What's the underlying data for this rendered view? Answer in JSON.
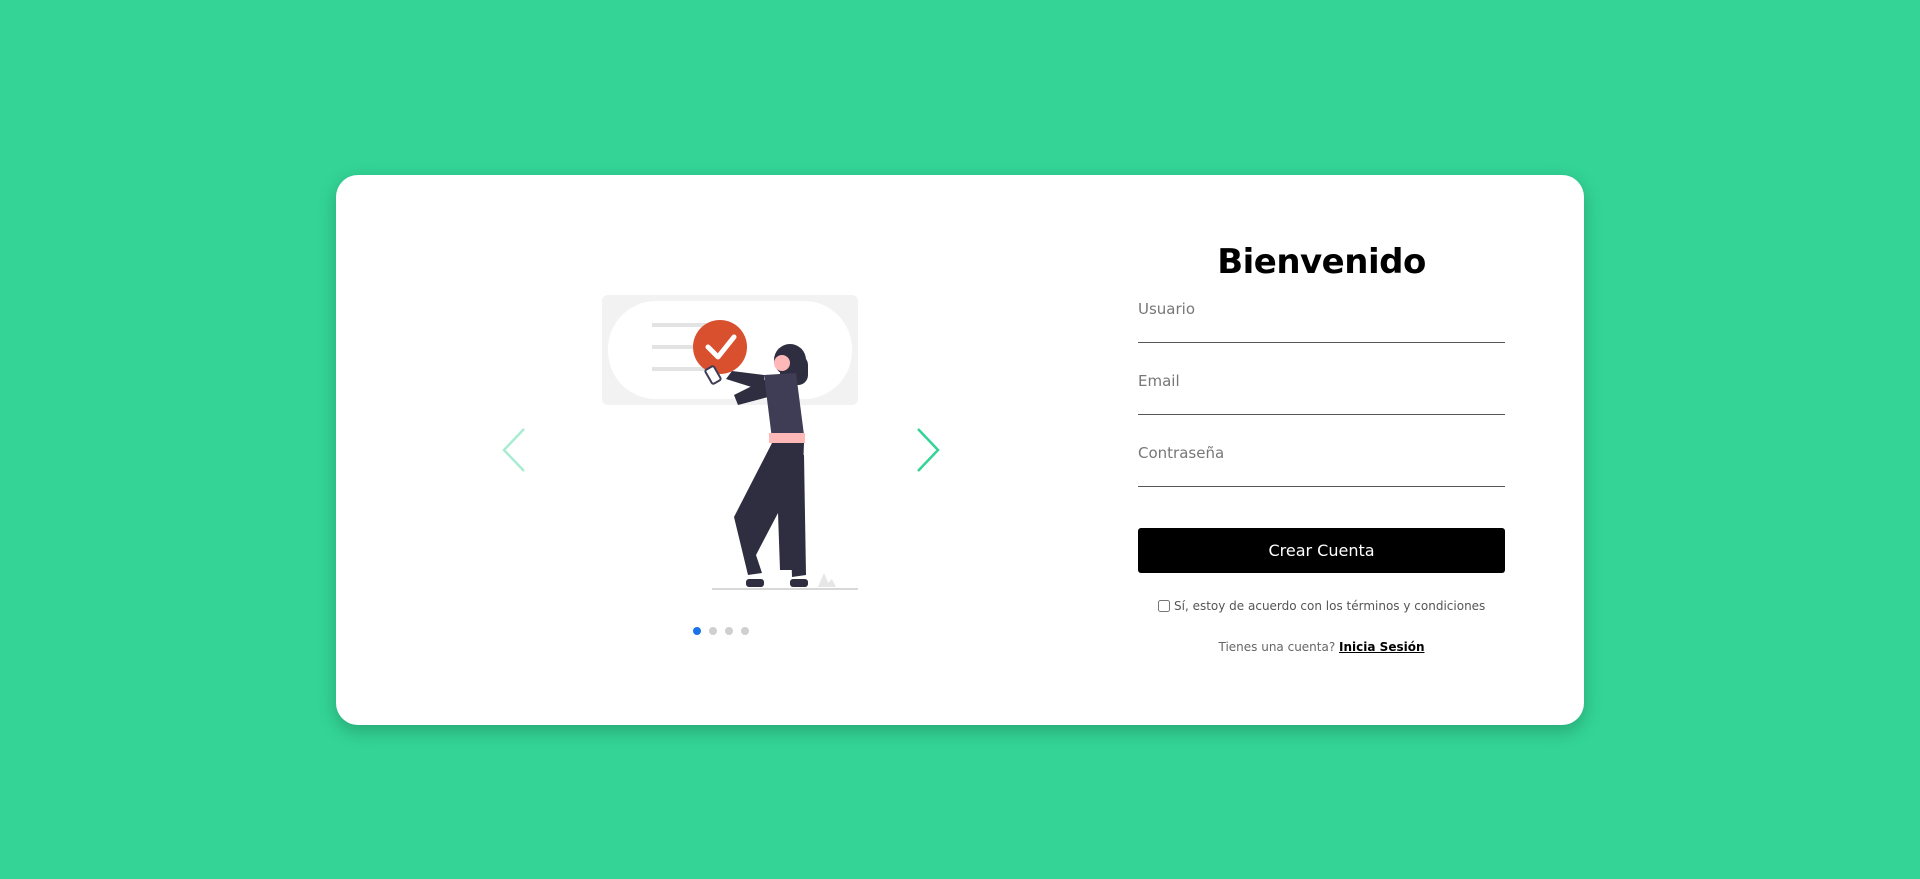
{
  "carousel": {
    "prev_icon": "chevron-left-icon",
    "next_icon": "chevron-right-icon",
    "slide_count": 4,
    "active_slide": 1
  },
  "form": {
    "title": "Bienvenido",
    "username_placeholder": "Usuario",
    "email_placeholder": "Email",
    "password_placeholder": "Contraseña",
    "submit_label": "Crear Cuenta",
    "terms_label": "Sí, estoy de acuerdo con los términos y condiciones",
    "login_prompt": "Tienes una cuenta?",
    "login_link": "Inicia Sesión"
  },
  "colors": {
    "background": "#33d496",
    "accent": "#33d496",
    "button": "#000000",
    "active_dot": "#1a73e8",
    "check_badge": "#d9502f"
  }
}
